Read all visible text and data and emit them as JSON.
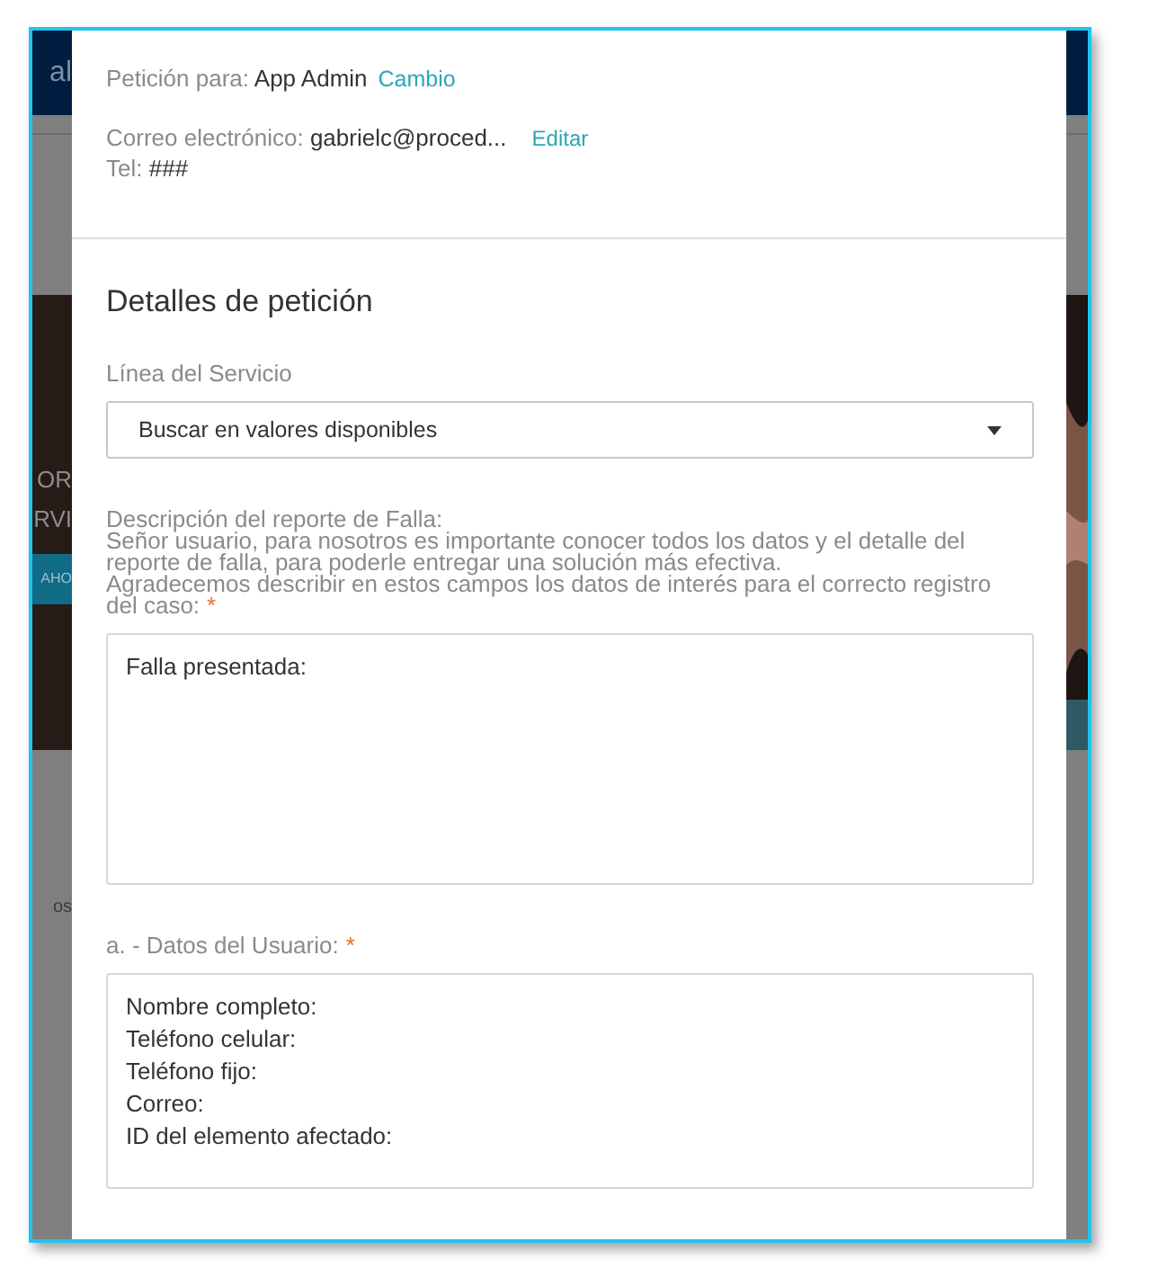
{
  "background": {
    "header_text": "al",
    "hero_lines": [
      "OR",
      "RVI"
    ],
    "hero_button": "AHO",
    "side_text": "os"
  },
  "request": {
    "for_label": "Petición para:",
    "for_value": "App Admin",
    "change_link": "Cambio",
    "email_label": "Correo electrónico:",
    "email_value": "gabrielc@proced...",
    "edit_link": "Editar",
    "phone_label": "Tel:",
    "phone_value": "###"
  },
  "details": {
    "title": "Detalles de petición",
    "fields": [
      {
        "kind": "select",
        "label_lines": [
          "Línea del Servicio"
        ],
        "placeholder": "Buscar en valores disponibles"
      },
      {
        "kind": "textarea",
        "label_lines": [
          "Descripción del reporte de Falla:",
          "Señor usuario, para nosotros es importante conocer todos los datos y el detalle del reporte de falla, para poderle entregar una solución más efectiva.",
          "Agradecemos describir en estos campos los datos de interés para el correcto registro del caso:"
        ],
        "required_mark": "*",
        "value_lines": [
          "Falla presentada:"
        ]
      },
      {
        "kind": "textarea",
        "label_lines": [
          "a. - Datos del Usuario:"
        ],
        "required_mark": "*",
        "value_lines": [
          "Nombre completo:",
          "Teléfono celular:",
          "Teléfono fijo:",
          "Correo:",
          "ID del elemento afectado:"
        ]
      }
    ]
  }
}
